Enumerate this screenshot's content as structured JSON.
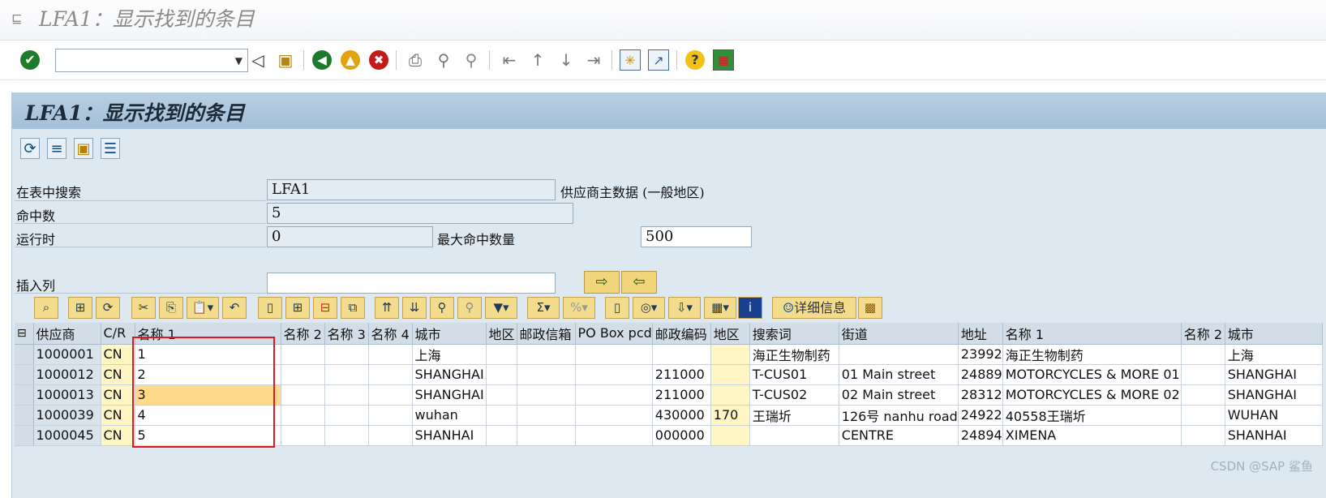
{
  "window": {
    "title": "LFA1：显示找到的条目"
  },
  "toolbar": {
    "command_field_value": "",
    "icons": [
      "enter-check-icon",
      "back-triangle-icon",
      "save-icon",
      "back-arrow-icon",
      "exit-up-icon",
      "cancel-x-icon",
      "print-icon",
      "find-icon",
      "find-next-icon",
      "first-page-icon",
      "prev-page-icon",
      "next-page-icon",
      "last-page-icon",
      "new-session-icon",
      "shortcut-icon",
      "help-icon",
      "layout-icon"
    ]
  },
  "panel": {
    "title": "LFA1：显示找到的条目"
  },
  "form": {
    "search_in_table_label": "在表中搜索",
    "search_in_table_value": "LFA1",
    "table_description": "供应商主数据 (一般地区)",
    "hits_label": "命中数",
    "hits_value": "5",
    "runtime_label": "运行时",
    "runtime_value": "0",
    "max_hits_label": "最大命中数量",
    "max_hits_value": "500",
    "insert_column_label": "插入列",
    "insert_column_value": ""
  },
  "alv_toolbar": {
    "detail_button_label": "详细信息"
  },
  "grid": {
    "columns": [
      "供应商",
      "C/R",
      "名称 1",
      "名称 2",
      "名称 3",
      "名称 4",
      "城市",
      "地区",
      "邮政信箱",
      "PO Box pcd",
      "邮政编码",
      "地区",
      "搜索词",
      "街道",
      "地址",
      "名称 1",
      "名称 2",
      "城市"
    ],
    "rows": [
      [
        "1000001",
        "CN",
        "1",
        "",
        "",
        "",
        "上海",
        "",
        "",
        "",
        "",
        "",
        "海正生物制药",
        "",
        "23992",
        "海正生物制药",
        "",
        "上海"
      ],
      [
        "1000012",
        "CN",
        "2",
        "",
        "",
        "",
        "SHANGHAI",
        "",
        "",
        "",
        "211000",
        "",
        "T-CUS01",
        "01 Main street",
        "24889",
        "MOTORCYCLES & MORE 01",
        "",
        "SHANGHAI"
      ],
      [
        "1000013",
        "CN",
        "3",
        "",
        "",
        "",
        "SHANGHAI",
        "",
        "",
        "",
        "211000",
        "",
        "T-CUS02",
        "02 Main street",
        "28312",
        "MOTORCYCLES & MORE 02",
        "",
        "SHANGHAI"
      ],
      [
        "1000039",
        "CN",
        "4",
        "",
        "",
        "",
        "wuhan",
        "",
        "",
        "",
        "430000",
        "170",
        "王瑞圻",
        "126号 nanhu road",
        "24922",
        "40558王瑞圻",
        "",
        "WUHAN"
      ],
      [
        "1000045",
        "CN",
        "5",
        "",
        "",
        "",
        "SHANHAI",
        "",
        "",
        "",
        "000000",
        "",
        "",
        "CENTRE",
        "24894",
        "XIMENA",
        "",
        "SHANHAI"
      ]
    ]
  },
  "watermark": "CSDN @SAP 鲨鱼"
}
